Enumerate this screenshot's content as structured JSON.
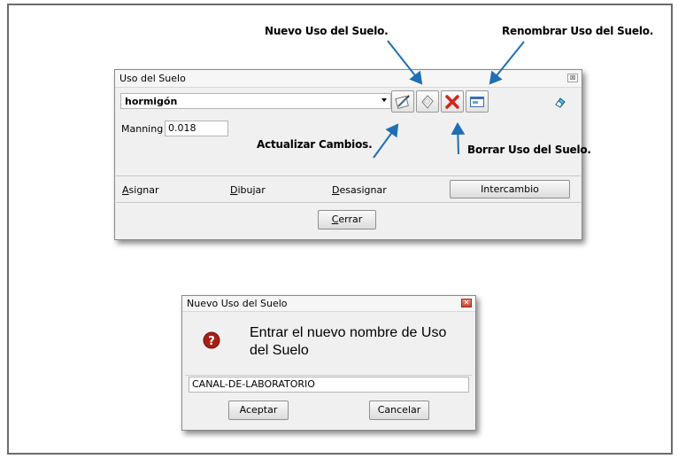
{
  "annotations": {
    "nuevo": "Nuevo Uso del Suelo.",
    "renombrar": "Renombrar Uso del Suelo.",
    "actualizar": "Actualizar Cambios.",
    "borrar": "Borrar Uso del Suelo."
  },
  "main_window": {
    "title": "Uso del Suelo",
    "close_glyph": "⊠",
    "combo_value": "hormigón",
    "manning_label": "Manning",
    "manning_value": "0.018",
    "actions": {
      "asignar": "Asignar",
      "dibujar": "Dibujar",
      "desasignar": "Desasignar",
      "intercambio": "Intercambio"
    },
    "cerrar": "Cerrar"
  },
  "dialog": {
    "title": "Nuevo Uso del Suelo",
    "close_glyph": "✕",
    "message": "Entrar el nuevo nombre de Uso del Suelo",
    "input_value": "CANAL-DE-LABORATORIO",
    "ok": "Aceptar",
    "cancel": "Cancelar"
  }
}
